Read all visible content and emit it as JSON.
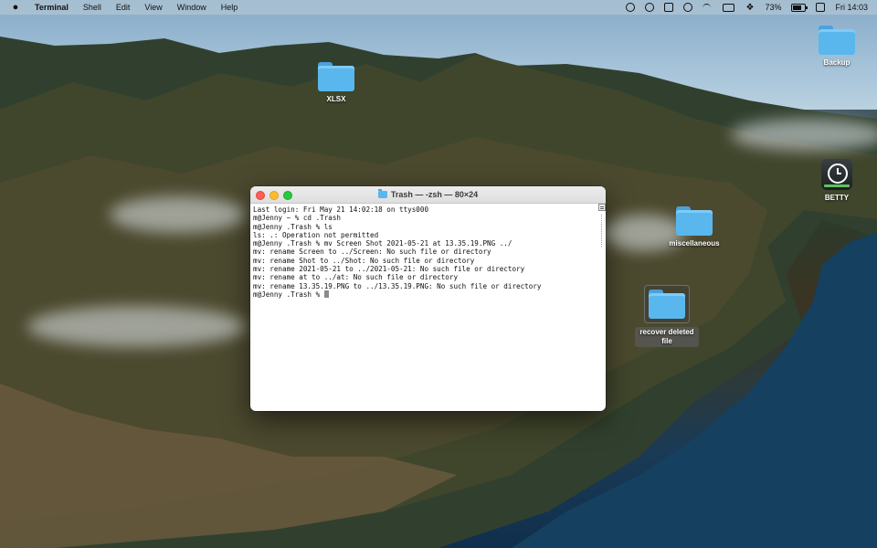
{
  "menubar": {
    "app_name": "Terminal",
    "menus": [
      "Shell",
      "Edit",
      "View",
      "Window",
      "Help"
    ],
    "battery_percent": "73%",
    "clock": "Fri 14:03"
  },
  "desktop": {
    "icons": [
      {
        "label": "XLSX"
      },
      {
        "label": "Backup"
      },
      {
        "label": "BETTY"
      },
      {
        "label": "miscellaneous"
      },
      {
        "label": "recover deleted file"
      }
    ]
  },
  "terminal": {
    "title": "Trash — -zsh — 80×24",
    "lines": [
      "Last login: Fri May 21 14:02:18 on ttys000",
      "m@Jenny ~ % cd .Trash",
      "m@Jenny .Trash % ls",
      "ls: .: Operation not permitted",
      "m@Jenny .Trash % mv Screen Shot 2021-05-21 at 13.35.19.PNG ../",
      "mv: rename Screen to ../Screen: No such file or directory",
      "mv: rename Shot to ../Shot: No such file or directory",
      "mv: rename 2021-05-21 to ../2021-05-21: No such file or directory",
      "mv: rename at to ../at: No such file or directory",
      "mv: rename 13.35.19.PNG to ../13.35.19.PNG: No such file or directory",
      "m@Jenny .Trash % "
    ]
  }
}
